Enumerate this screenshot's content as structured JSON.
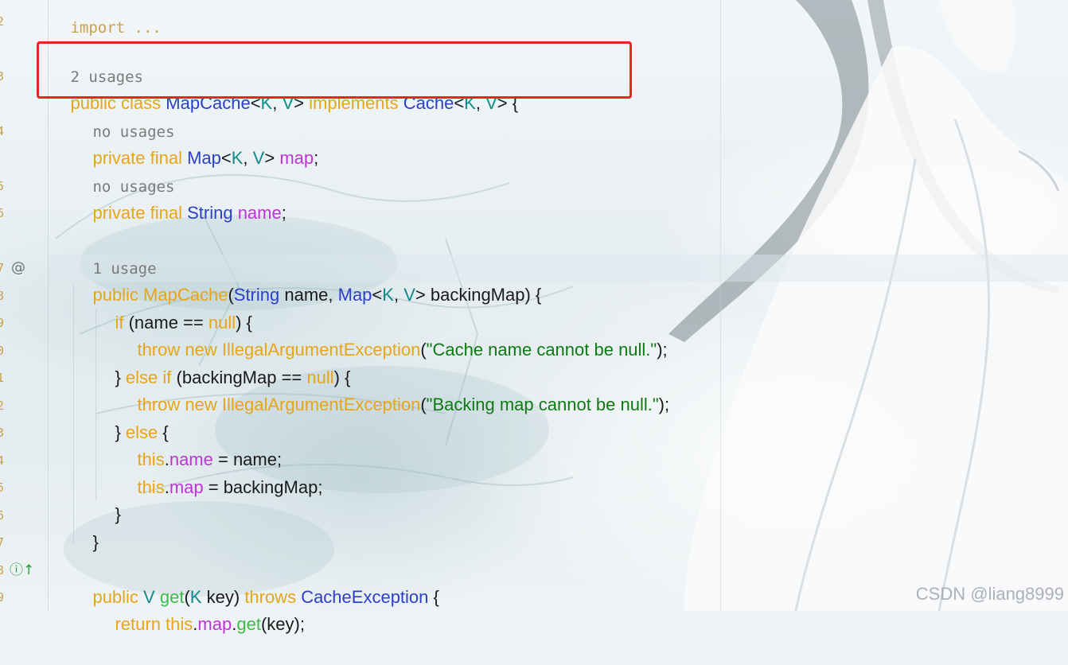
{
  "watermark": "CSDN @liang8999",
  "gutter": {
    "line_numbers": [
      "2",
      "3",
      "4",
      "5",
      "6",
      "7",
      "8",
      "9",
      "0",
      "1",
      "2",
      "3",
      "4",
      "5",
      "6",
      "7",
      "8",
      "9"
    ],
    "annotation_icon": "@",
    "implements_icon": "ⓘ↑"
  },
  "code": {
    "l0": {
      "hint": "import ..."
    },
    "l1": {
      "hint": "2 usages"
    },
    "l2": {
      "t1": "public class ",
      "t2": "MapCache",
      "t3": "<",
      "t4": "K",
      "t5": ", ",
      "t6": "V",
      "t7": "> ",
      "t8": "implements ",
      "t9": "Cache",
      "t10": "<",
      "t11": "K",
      "t12": ", ",
      "t13": "V",
      "t14": "> {"
    },
    "l3": {
      "hint": "no usages"
    },
    "l4": {
      "t1": "private final ",
      "t2": "Map",
      "t3": "<",
      "t4": "K",
      "t5": ", ",
      "t6": "V",
      "t7": "> ",
      "t8": "map",
      "t9": ";"
    },
    "l5": {
      "hint": "no usages"
    },
    "l6": {
      "t1": "private final ",
      "t2": "String",
      "t3": " ",
      "t4": "name",
      "t5": ";"
    },
    "l7": {
      "hint": "1 usage"
    },
    "l8": {
      "t1": "public ",
      "t2": "MapCache",
      "t3": "(",
      "t4": "String",
      "t5": " name, ",
      "t6": "Map",
      "t7": "<",
      "t8": "K",
      "t9": ", ",
      "t10": "V",
      "t11": "> backingMap) {"
    },
    "l9": {
      "t1": "if",
      "t2": " (name == ",
      "t3": "null",
      "t4": ") {"
    },
    "l10": {
      "t1": "throw new ",
      "t2": "IllegalArgumentException",
      "t3": "(",
      "t4": "\"Cache name cannot be null.\"",
      "t5": ");"
    },
    "l11": {
      "t1": "} ",
      "t2": "else if",
      "t3": " (backingMap == ",
      "t4": "null",
      "t5": ") {"
    },
    "l12": {
      "t1": "throw new ",
      "t2": "IllegalArgumentException",
      "t3": "(",
      "t4": "\"Backing map cannot be null.\"",
      "t5": ");"
    },
    "l13": {
      "t1": "} ",
      "t2": "else",
      "t3": " {"
    },
    "l14": {
      "t1": "this",
      "t2": ".",
      "t3": "name",
      "t4": " = name;"
    },
    "l15": {
      "t1": "this",
      "t2": ".",
      "t3": "map",
      "t4": " = backingMap;"
    },
    "l16": {
      "t1": "}"
    },
    "l17": {
      "t1": "}"
    },
    "l18": {
      "t1": "public ",
      "t2": "V",
      "t3": " ",
      "t4": "get",
      "t5": "(",
      "t6": "K",
      "t7": " key) ",
      "t8": "throws ",
      "t9": "CacheException",
      "t10": " {"
    },
    "l19": {
      "t1": "return ",
      "t2": "this",
      "t3": ".",
      "t4": "map",
      "t5": ".",
      "t6": "get",
      "t7": "(key);"
    }
  },
  "colors": {
    "keyword": "#e7a51a",
    "class": "#2b3fc7",
    "type_param": "#128a8a",
    "field": "#bd34d6",
    "string": "#0e7a14",
    "method": "#3dbd46",
    "highlight_box": "#e4261f"
  }
}
